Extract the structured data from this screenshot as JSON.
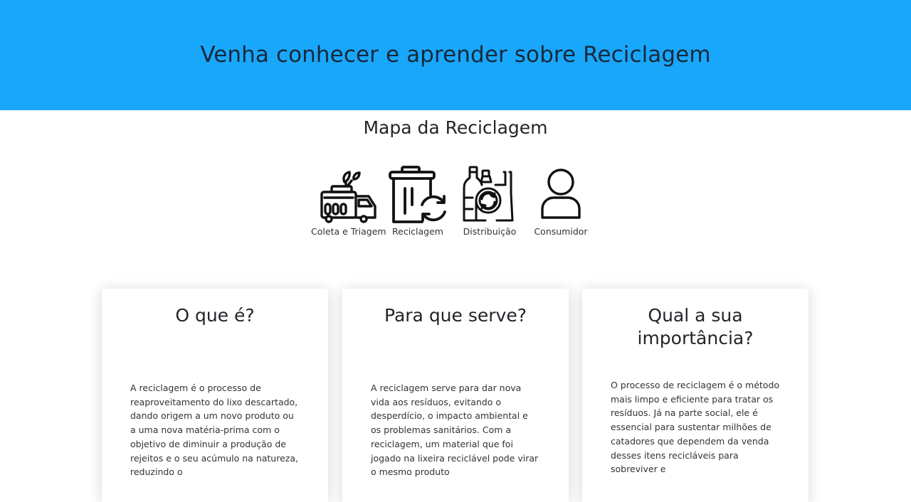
{
  "hero": {
    "title": "Venha conhecer e aprender sobre Reciclagem",
    "background": "#19a7fc"
  },
  "map": {
    "title": "Mapa da Reciclagem",
    "steps": [
      {
        "label": "Coleta e Triagem",
        "icon": "garbage-truck-icon"
      },
      {
        "label": "Reciclagem",
        "icon": "recycle-bin-icon"
      },
      {
        "label": "Distribuição",
        "icon": "recycled-bottles-icon"
      },
      {
        "label": "Consumidor",
        "icon": "user-icon"
      }
    ]
  },
  "cards": [
    {
      "title": "O que é?",
      "text": "A reciclagem é o processo de reaproveitamento do lixo descartado, dando origem a um novo produto ou a uma nova matéria-prima com o objetivo de diminuir a produção de rejeitos e o seu acúmulo na natureza, reduzindo o"
    },
    {
      "title": "Para que serve?",
      "text": "A reciclagem serve para dar nova vida aos resíduos, evitando o desperdício, o impacto ambiental e os problemas sanitários. Com a reciclagem, um material que foi jogado na lixeira reciclável pode virar o mesmo produto"
    },
    {
      "title": "Qual a sua importância?",
      "text": "O processo de reciclagem é o método mais limpo e eficiente para tratar os resíduos. Já na parte social, ele é essencial para sustentar milhões de catadores que dependem da venda desses itens recicláveis para sobreviver e"
    }
  ]
}
